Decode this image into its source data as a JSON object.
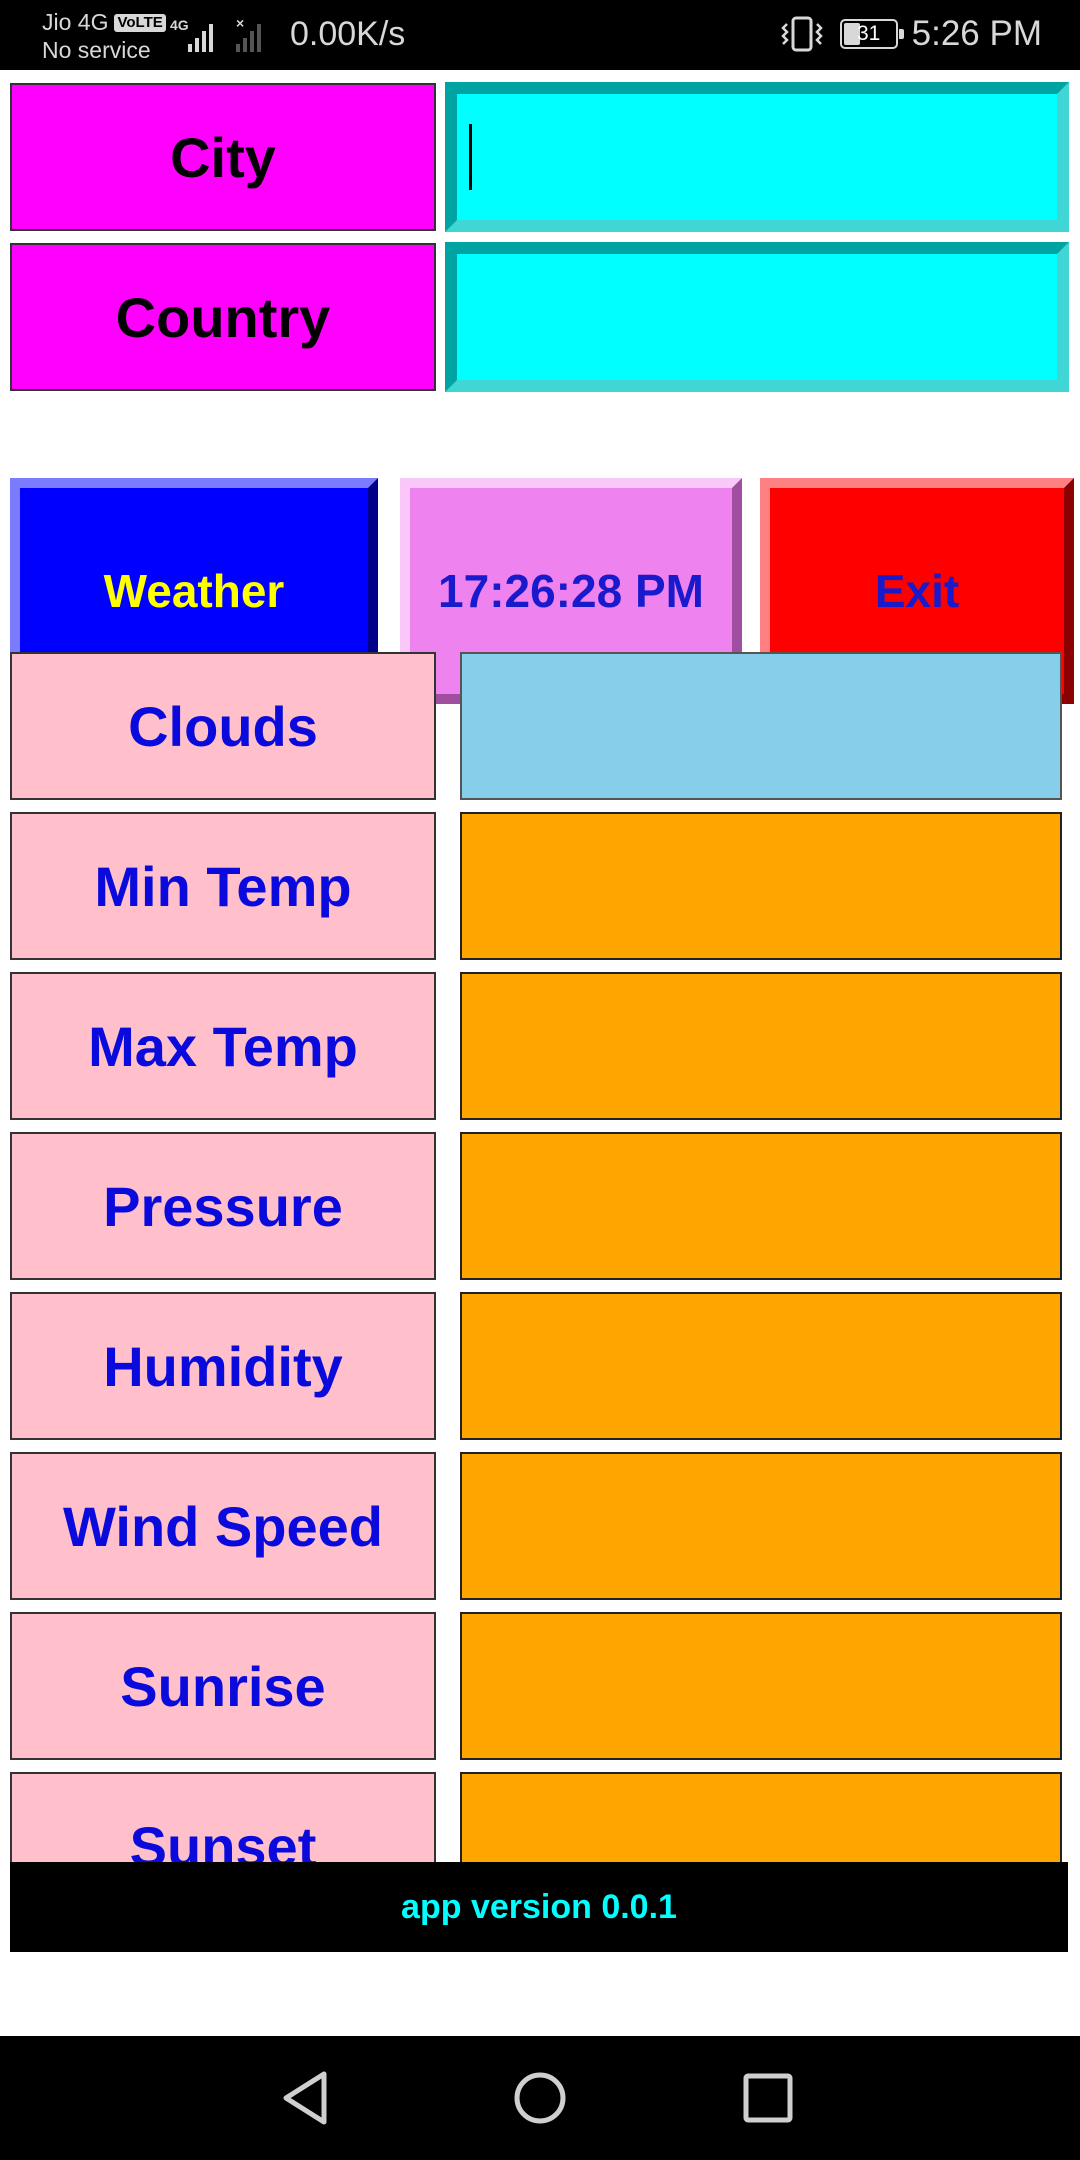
{
  "status_bar": {
    "carrier": "Jio 4G",
    "volte": "VoLTE",
    "service": "No service",
    "network_type": "4G",
    "speed": "0.00K/s",
    "battery": "31",
    "time": "5:26 PM"
  },
  "form": {
    "city_label": "City",
    "city_value": "",
    "country_label": "Country",
    "country_value": ""
  },
  "actions": {
    "weather_label": "Weather",
    "clock_label": "17:26:28 PM",
    "exit_label": "Exit"
  },
  "fields": [
    {
      "label": "Clouds",
      "value": ""
    },
    {
      "label": "Min Temp",
      "value": ""
    },
    {
      "label": "Max Temp",
      "value": ""
    },
    {
      "label": "Pressure",
      "value": ""
    },
    {
      "label": "Humidity",
      "value": ""
    },
    {
      "label": "Wind Speed",
      "value": ""
    },
    {
      "label": "Sunrise",
      "value": ""
    },
    {
      "label": "Sunset",
      "value": ""
    }
  ],
  "footer": {
    "version": "app version 0.0.1"
  },
  "colors": {
    "input_label_bg": "#ff00ff",
    "input_bg": "#00ffff",
    "weather_bg": "#0000ff",
    "weather_text": "#ffff00",
    "clock_bg": "#ee82ee",
    "exit_bg": "#ff0000",
    "field_label_bg": "#ffc0cb",
    "field_label_text": "#0a0adc",
    "clouds_value_bg": "#87ceeb",
    "field_value_bg": "#ffa500",
    "footer_text": "#00ffff"
  },
  "icons": {
    "nav_back": "back-triangle-icon",
    "nav_home": "home-circle-icon",
    "nav_recent": "recent-square-icon"
  }
}
